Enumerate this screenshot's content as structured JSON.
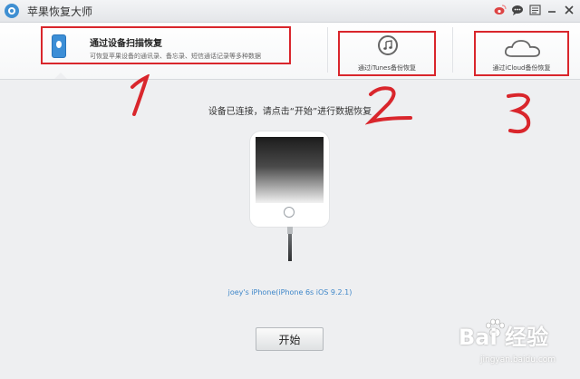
{
  "app": {
    "title": "苹果恢复大师",
    "titlebar_icons": [
      "weibo-icon",
      "chat-icon",
      "feedback-icon",
      "minimize-icon",
      "close-icon"
    ]
  },
  "header": {
    "tabs": [
      {
        "title": "通过设备扫描恢复",
        "description": "可恢复苹果设备的通讯录、备忘录、短信通话记录等多种数据",
        "icon": "phone-icon",
        "selected": true
      },
      {
        "label": "通过iTunes备份恢复",
        "icon": "music-note-icon"
      },
      {
        "label": "通过iCloud备份恢复",
        "icon": "cloud-icon"
      }
    ]
  },
  "main": {
    "status_text": "设备已连接，请点击“开始”进行数据恢复",
    "device_name": "joey's iPhone(iPhone 6s iOS 9.2.1)",
    "start_label": "开始"
  },
  "annotations": [
    "1",
    "2",
    "3"
  ],
  "watermark": {
    "logo": "Bai 经验",
    "url": "jingyan.baidu.com"
  },
  "colors": {
    "accent_blue": "#3f8fd2",
    "annotation_red": "#d9262c",
    "device_name_blue": "#3f87c9"
  }
}
